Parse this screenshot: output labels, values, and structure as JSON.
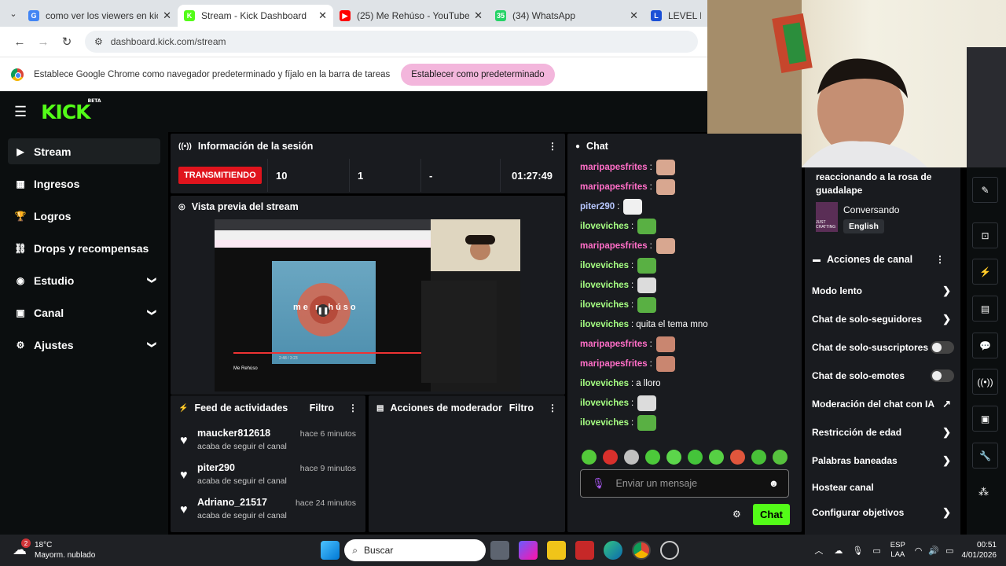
{
  "tabs": [
    {
      "title": "como ver los viewers en kick - Go",
      "color": "#4285f4",
      "letter": "G"
    },
    {
      "title": "Stream - Kick Dashboard",
      "color": "#53fc18",
      "letter": "K"
    },
    {
      "title": "(25) Me Rehúso - YouTube",
      "color": "#ff0000",
      "letter": "▶"
    },
    {
      "title": "(34) WhatsApp",
      "color": "#25d366",
      "letter": "35"
    },
    {
      "title": "LEVEL DEV",
      "color": "#1a4fd6",
      "letter": "L"
    }
  ],
  "url": "dashboard.kick.com/stream",
  "infobar": {
    "text": "Establece Google Chrome como navegador predeterminado y fíjalo en la barra de tareas",
    "button": "Establecer como predeterminado"
  },
  "logo": {
    "text": "KICK",
    "beta": "BETA"
  },
  "sidebar": [
    {
      "label": "Stream",
      "icon": "▶",
      "expand": false
    },
    {
      "label": "Ingresos",
      "icon": "▦",
      "expand": false
    },
    {
      "label": "Logros",
      "icon": "🏆",
      "expand": false
    },
    {
      "label": "Drops y recompensas",
      "icon": "⛓",
      "expand": false
    },
    {
      "label": "Estudio",
      "icon": "◉",
      "expand": true
    },
    {
      "label": "Canal",
      "icon": "▣",
      "expand": true
    },
    {
      "label": "Ajustes",
      "icon": "⚙",
      "expand": true
    }
  ],
  "session": {
    "title": "Información de la sesión",
    "status": "TRANSMITIENDO",
    "viewers": "10",
    "followers": "1",
    "dash": "-",
    "time": "01:27:49"
  },
  "preview": {
    "title": "Vista previa del stream",
    "video_title": "me rehúso",
    "video_name": "Me Rehúso",
    "elapsed": "2:48 / 3:23"
  },
  "activity": {
    "title": "Feed de actividades",
    "filter": "Filtro",
    "items": [
      {
        "user": "maucker812618",
        "time": "hace 6 minutos",
        "text": "acaba de seguir el canal"
      },
      {
        "user": "piter290",
        "time": "hace 9 minutos",
        "text": "acaba de seguir el canal"
      },
      {
        "user": "Adriano_21517",
        "time": "hace 24 minutos",
        "text": "acaba de seguir el canal"
      }
    ]
  },
  "moderator": {
    "title": "Acciones de moderador",
    "filter": "Filtro"
  },
  "chat": {
    "title": "Chat",
    "messages": [
      {
        "user": "maripapesfrites",
        "color": "#ff6ec7",
        "text": "",
        "emote": "#d8a790"
      },
      {
        "user": "maripapesfrites",
        "color": "#ff6ec7",
        "text": "",
        "emote": "#d8a790"
      },
      {
        "user": "piter290",
        "color": "#b8c8ff",
        "text": "",
        "emote": "#f0f0f0"
      },
      {
        "user": "iloveviches",
        "color": "#a6ff83",
        "text": "",
        "emote": "#59b043"
      },
      {
        "user": "maripapesfrites",
        "color": "#ff6ec7",
        "text": "",
        "emote": "#d8a790"
      },
      {
        "user": "iloveviches",
        "color": "#a6ff83",
        "text": "",
        "emote": "#59b043"
      },
      {
        "user": "iloveviches",
        "color": "#a6ff83",
        "text": "",
        "emote": "#dcdcdc"
      },
      {
        "user": "iloveviches",
        "color": "#a6ff83",
        "text": "",
        "emote": "#59b043"
      },
      {
        "user": "iloveviches",
        "color": "#a6ff83",
        "text": "quita el tema mno",
        "emote": ""
      },
      {
        "user": "maripapesfrites",
        "color": "#ff6ec7",
        "text": "",
        "emote": "#c98670"
      },
      {
        "user": "maripapesfrites",
        "color": "#ff6ec7",
        "text": "",
        "emote": "#c98670"
      },
      {
        "user": "iloveviches",
        "color": "#a6ff83",
        "text": "a lloro",
        "emote": ""
      },
      {
        "user": "iloveviches",
        "color": "#a6ff83",
        "text": "",
        "emote": "#dcdcdc"
      },
      {
        "user": "iloveviches",
        "color": "#a6ff83",
        "text": "",
        "emote": "#59b043"
      }
    ],
    "placeholder": "Enviar un mensaje",
    "send": "Chat"
  },
  "stream_info": {
    "title_line1": "reaccionando a la rosa de",
    "title_line2": "guadalape",
    "category": "Conversando",
    "language": "English",
    "category_thumb": "JUST CHATTING"
  },
  "channel_actions": {
    "title": "Acciones de canal",
    "items": [
      {
        "label": "Modo lento",
        "type": "arrow"
      },
      {
        "label": "Chat de solo-seguidores",
        "type": "arrow"
      },
      {
        "label": "Chat de solo-suscriptores",
        "type": "toggle"
      },
      {
        "label": "Chat de solo-emotes",
        "type": "toggle"
      },
      {
        "label": "Moderación del chat con IA",
        "type": "external"
      },
      {
        "label": "Restricción de edad",
        "type": "arrow"
      },
      {
        "label": "Palabras baneadas",
        "type": "arrow"
      },
      {
        "label": "Hostear canal",
        "type": "none"
      },
      {
        "label": "Configurar objetivos",
        "type": "arrow"
      }
    ]
  },
  "taskbar": {
    "temp": "18°C",
    "weather": "Mayorm. nublado",
    "badge": "2",
    "search": "Buscar",
    "lang1": "ESP",
    "lang2": "LAA",
    "time": "00:51",
    "date": "4/01/2026"
  },
  "colors": {
    "kick_green": "#53fc18",
    "live_red": "#e0141d",
    "panel": "#191b1f"
  }
}
